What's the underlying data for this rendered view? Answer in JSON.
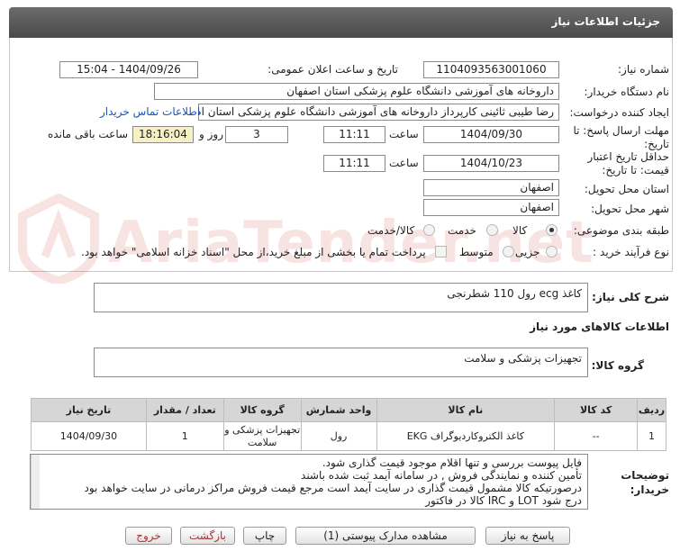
{
  "header": {
    "title": "جزئیات اطلاعات نیاز"
  },
  "form": {
    "need_number_label": "شماره نیاز:",
    "need_number": "1104093563001060",
    "announce_label": "تاریخ و ساعت اعلان عمومی:",
    "announce_value": "1404/09/26 - 15:04",
    "buyer_org_label": "نام دستگاه خریدار:",
    "buyer_org": "داروخانه های آموزشی دانشگاه علوم پزشکی استان اصفهان",
    "requester_label": "ایجاد کننده درخواست:",
    "requester": "رضا طیبی ثائینی کارپرداز داروخانه های آموزشی دانشگاه علوم پزشکی استان اصفهان",
    "contact_link": "اطلاعات تماس خریدار",
    "reply_deadline_label": "مهلت ارسال پاسخ: تا تاریخ:",
    "reply_date": "1404/09/30",
    "time_label": "ساعت",
    "reply_time": "11:11",
    "days_value": "3",
    "days_label": "روز و",
    "remaining_time": "18:16:04",
    "remaining_label": "ساعت باقی مانده",
    "price_validity_label": "حداقل تاریخ اعتبار قیمت: تا تاریخ:",
    "validity_date": "1404/10/23",
    "validity_time": "11:11",
    "province_label": "استان محل تحویل:",
    "province": "اصفهان",
    "city_label": "شهر محل تحویل:",
    "city": "اصفهان",
    "category_label": "طبقه بندی موضوعی:",
    "category_goods": "کالا",
    "category_service": "خدمت",
    "category_goods_service": "کالا/خدمت",
    "process_label": "نوع فرآیند خرید :",
    "process_minor": "جزیی",
    "process_medium": "متوسط",
    "payment_note": "پرداخت تمام یا بخشی از مبلغ خرید،از محل \"اسناد خزانه اسلامی\" خواهد بود."
  },
  "summary": {
    "label": "شرح کلی نیاز:",
    "text": "کاغذ  ecg   رول 110 شطرنجی"
  },
  "goods_info": {
    "section_title": "اطلاعات کالاهای مورد نیاز",
    "group_label": "گروه کالا:",
    "group_value": "تجهیزات پزشکی و سلامت"
  },
  "table": {
    "headers": [
      "ردیف",
      "کد کالا",
      "نام کالا",
      "واحد شمارش",
      "گروه کالا",
      "تعداد / مقدار",
      "تاریخ نیاز"
    ],
    "rows": [
      [
        "1",
        "--",
        "کاغذ الکتروکاردیوگراف EKG",
        "رول",
        "تجهیزات پزشکی و سلامت",
        "1",
        "1404/09/30"
      ]
    ]
  },
  "buyer_notes": {
    "label": "توضیحات خریدار:",
    "lines": [
      "فایل پیوست بررسی و تنها اقلام موجود قیمت گذاری شود.",
      "تأمین کننده و نمایندگی فروش  ,  در سامانه آیمد ثبت شده باشند",
      "درصورتیکه کالا مشمول قیمت گذاری در سایت آیمد است مرجع قیمت فروش مراکز درمانی در سایت خواهد بود",
      "درج شود LOT و IRC کالا در فاکتور"
    ]
  },
  "buttons": {
    "reply": "پاسخ به نیاز",
    "attachments": "مشاهده مدارک پیوستی (1)",
    "print": "چاپ",
    "back": "بازگشت",
    "exit": "خروج"
  },
  "watermark": {
    "text": "AriaTender.net"
  }
}
